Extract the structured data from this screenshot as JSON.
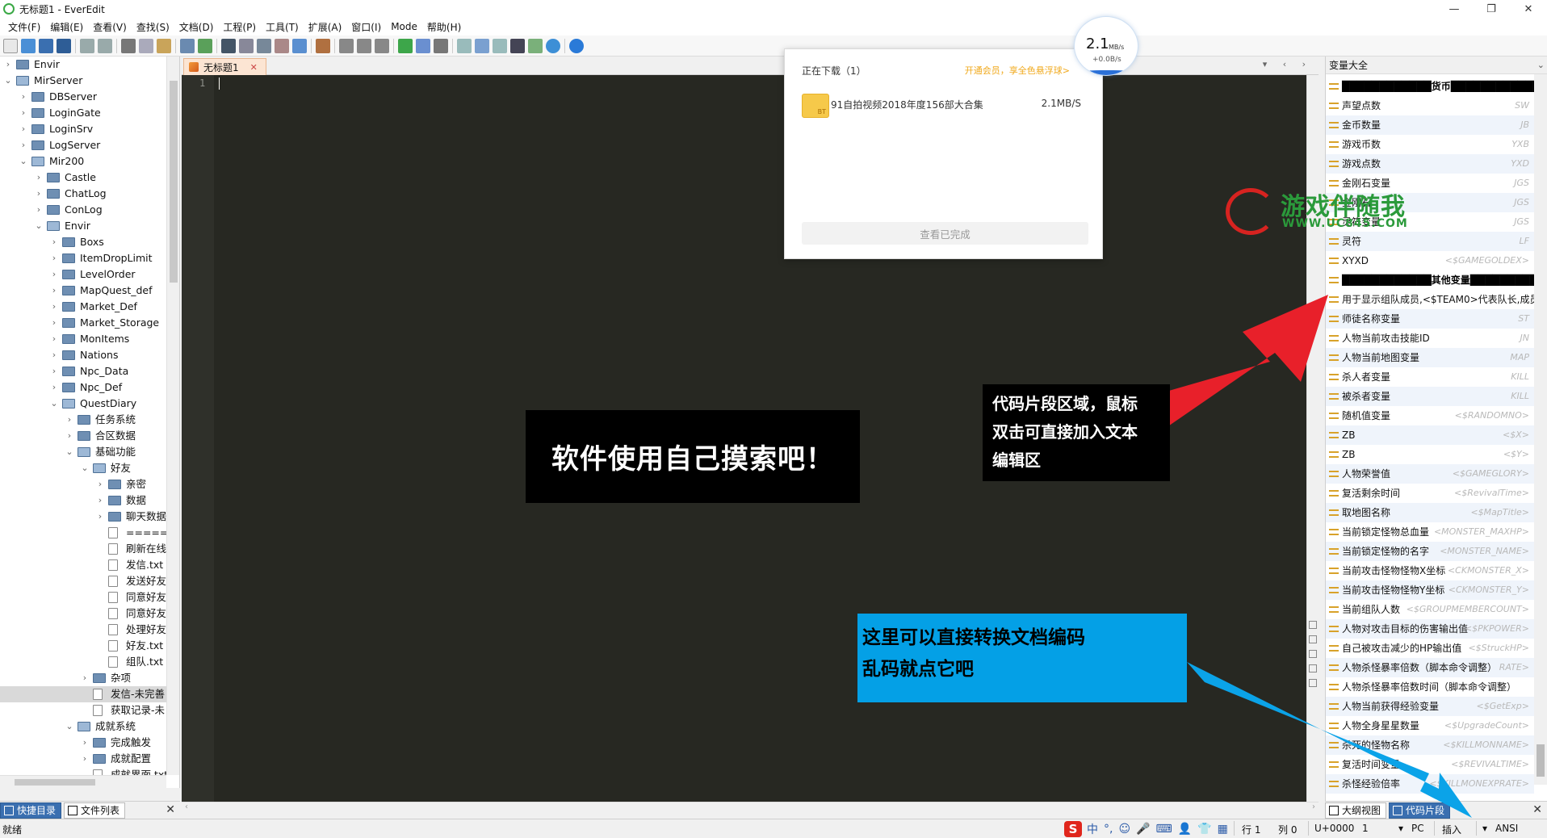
{
  "window": {
    "title": "无标题1 - EverEdit",
    "controls": [
      "—",
      "❐",
      "✕"
    ]
  },
  "menu": [
    "文件(F)",
    "编辑(E)",
    "查看(V)",
    "查找(S)",
    "文档(D)",
    "工程(P)",
    "工具(T)",
    "扩展(A)",
    "窗口(I)",
    "Mode",
    "帮助(H)"
  ],
  "file_tree": [
    {
      "label": "Envir",
      "depth": 0,
      "twisty": "›",
      "icon": "folder"
    },
    {
      "label": "MirServer",
      "depth": 0,
      "twisty": "⌄",
      "icon": "folder-open"
    },
    {
      "label": "DBServer",
      "depth": 1,
      "twisty": "›",
      "icon": "folder"
    },
    {
      "label": "LoginGate",
      "depth": 1,
      "twisty": "›",
      "icon": "folder"
    },
    {
      "label": "LoginSrv",
      "depth": 1,
      "twisty": "›",
      "icon": "folder"
    },
    {
      "label": "LogServer",
      "depth": 1,
      "twisty": "›",
      "icon": "folder"
    },
    {
      "label": "Mir200",
      "depth": 1,
      "twisty": "⌄",
      "icon": "folder-open"
    },
    {
      "label": "Castle",
      "depth": 2,
      "twisty": "›",
      "icon": "folder"
    },
    {
      "label": "ChatLog",
      "depth": 2,
      "twisty": "›",
      "icon": "folder"
    },
    {
      "label": "ConLog",
      "depth": 2,
      "twisty": "›",
      "icon": "folder"
    },
    {
      "label": "Envir",
      "depth": 2,
      "twisty": "⌄",
      "icon": "folder-open"
    },
    {
      "label": "Boxs",
      "depth": 3,
      "twisty": "›",
      "icon": "folder"
    },
    {
      "label": "ItemDropLimit",
      "depth": 3,
      "twisty": "›",
      "icon": "folder"
    },
    {
      "label": "LevelOrder",
      "depth": 3,
      "twisty": "›",
      "icon": "folder"
    },
    {
      "label": "MapQuest_def",
      "depth": 3,
      "twisty": "›",
      "icon": "folder"
    },
    {
      "label": "Market_Def",
      "depth": 3,
      "twisty": "›",
      "icon": "folder"
    },
    {
      "label": "Market_Storage",
      "depth": 3,
      "twisty": "›",
      "icon": "folder"
    },
    {
      "label": "MonItems",
      "depth": 3,
      "twisty": "›",
      "icon": "folder"
    },
    {
      "label": "Nations",
      "depth": 3,
      "twisty": "›",
      "icon": "folder"
    },
    {
      "label": "Npc_Data",
      "depth": 3,
      "twisty": "›",
      "icon": "folder"
    },
    {
      "label": "Npc_Def",
      "depth": 3,
      "twisty": "›",
      "icon": "folder"
    },
    {
      "label": "QuestDiary",
      "depth": 3,
      "twisty": "⌄",
      "icon": "folder-open"
    },
    {
      "label": "任务系统",
      "depth": 4,
      "twisty": "›",
      "icon": "folder"
    },
    {
      "label": "合区数据",
      "depth": 4,
      "twisty": "›",
      "icon": "folder"
    },
    {
      "label": "基础功能",
      "depth": 4,
      "twisty": "⌄",
      "icon": "folder-open"
    },
    {
      "label": "好友",
      "depth": 5,
      "twisty": "⌄",
      "icon": "folder-open"
    },
    {
      "label": "亲密",
      "depth": 6,
      "twisty": "›",
      "icon": "folder"
    },
    {
      "label": "数据",
      "depth": 6,
      "twisty": "›",
      "icon": "folder"
    },
    {
      "label": "聊天数据",
      "depth": 6,
      "twisty": "›",
      "icon": "folder"
    },
    {
      "label": "======",
      "depth": 6,
      "twisty": "",
      "icon": "file"
    },
    {
      "label": "刷新在线",
      "depth": 6,
      "twisty": "",
      "icon": "file"
    },
    {
      "label": "发信.txt",
      "depth": 6,
      "twisty": "",
      "icon": "file"
    },
    {
      "label": "发送好友",
      "depth": 6,
      "twisty": "",
      "icon": "file"
    },
    {
      "label": "同意好友",
      "depth": 6,
      "twisty": "",
      "icon": "file"
    },
    {
      "label": "同意好友",
      "depth": 6,
      "twisty": "",
      "icon": "file"
    },
    {
      "label": "处理好友",
      "depth": 6,
      "twisty": "",
      "icon": "file"
    },
    {
      "label": "好友.txt",
      "depth": 6,
      "twisty": "",
      "icon": "file"
    },
    {
      "label": "组队.txt",
      "depth": 6,
      "twisty": "",
      "icon": "file"
    },
    {
      "label": "杂项",
      "depth": 5,
      "twisty": "›",
      "icon": "folder"
    },
    {
      "label": "发信-未完善",
      "depth": 5,
      "twisty": "",
      "icon": "file",
      "selected": true
    },
    {
      "label": "获取记录-未",
      "depth": 5,
      "twisty": "",
      "icon": "file"
    },
    {
      "label": "成就系统",
      "depth": 4,
      "twisty": "⌄",
      "icon": "folder-open"
    },
    {
      "label": "完成触发",
      "depth": 5,
      "twisty": "›",
      "icon": "folder"
    },
    {
      "label": "成就配置",
      "depth": 5,
      "twisty": "›",
      "icon": "folder"
    },
    {
      "label": "成就界面.txt",
      "depth": 5,
      "twisty": "",
      "icon": "file"
    }
  ],
  "left_tabs": {
    "quick_dir": "快捷目录",
    "file_list": "文件列表",
    "close": "✕"
  },
  "editor": {
    "tab_label": "无标题1",
    "tab_close": "✕",
    "line_number": "1",
    "nav": "▾ ‹ ›"
  },
  "overlay_text": "软件使用自己摸索吧！",
  "download_popup": {
    "title": "正在下载（1）",
    "promo": "开通会员，享全色悬浮球>",
    "file_name": "91自拍视频2018年度156部大合集",
    "speed": "2.1MB/S",
    "button": "查看已完成"
  },
  "speed_bubble": {
    "value": "2.1",
    "unit": "MB/s",
    "upload": "+0.0B/s"
  },
  "snippet_panel": {
    "title": "变量大全",
    "items": [
      {
        "name": "████████████货币████████████",
        "key": "",
        "head": true
      },
      {
        "name": "声望点数",
        "key": "SW"
      },
      {
        "name": "金币数量",
        "key": "JB"
      },
      {
        "name": "游戏币数",
        "key": "YXB"
      },
      {
        "name": "游戏点数",
        "key": "YXD"
      },
      {
        "name": "金刚石变量",
        "key": "JGS"
      },
      {
        "name": "金刚石",
        "key": "JGS"
      },
      {
        "name": "灵符变量",
        "key": "JGS"
      },
      {
        "name": "灵符",
        "key": "LF"
      },
      {
        "name": "XYXD",
        "key": "<$GAMEGOLDEX>"
      },
      {
        "name": "████████████其他变量████████████",
        "key": "",
        "head": true
      },
      {
        "name": "用于显示组队成员,<$TEAM0>代表队长,成员",
        "key": ""
      },
      {
        "name": "师徒名称变量",
        "key": "ST"
      },
      {
        "name": "人物当前攻击技能ID",
        "key": "JN"
      },
      {
        "name": "人物当前地图变量",
        "key": "MAP"
      },
      {
        "name": "杀人者变量",
        "key": "KILL"
      },
      {
        "name": "被杀者变量",
        "key": "KILL"
      },
      {
        "name": "随机值变量",
        "key": "<$RANDOMNO>"
      },
      {
        "name": "ZB",
        "key": "<$X>"
      },
      {
        "name": "ZB",
        "key": "<$Y>"
      },
      {
        "name": "人物荣誉值",
        "key": "<$GAMEGLORY>"
      },
      {
        "name": "复活剩余时间",
        "key": "<$RevivalTime>"
      },
      {
        "name": "取地图名称",
        "key": "<$MapTitle>"
      },
      {
        "name": "当前锁定怪物总血量",
        "key": "<MONSTER_MAXHP>"
      },
      {
        "name": "当前锁定怪物的名字",
        "key": "<MONSTER_NAME>"
      },
      {
        "name": "当前攻击怪物怪物X坐标",
        "key": "<CKMONSTER_X>"
      },
      {
        "name": "当前攻击怪物怪物Y坐标",
        "key": "<CKMONSTER_Y>"
      },
      {
        "name": "当前组队人数",
        "key": "<$GROUPMEMBERCOUNT>"
      },
      {
        "name": "人物对攻击目标的伤害输出值",
        "key": "<$PKPOWER>"
      },
      {
        "name": "自己被攻击减少的HP输出值",
        "key": "<$StruckHP>"
      },
      {
        "name": "人物杀怪暴率倍数（脚本命令调整）",
        "key": "RATE>"
      },
      {
        "name": "人物杀怪暴率倍数时间（脚本命令调整）",
        "key": ""
      },
      {
        "name": "人物当前获得经验变量",
        "key": "<$GetExp>"
      },
      {
        "name": "人物全身星星数量",
        "key": "<$UpgradeCount>"
      },
      {
        "name": "杀死的怪物名称",
        "key": "<$KILLMONNAME>"
      },
      {
        "name": "复活时间变量",
        "key": "<$REVIVALTIME>"
      },
      {
        "name": "杀怪经验倍率",
        "key": "<$KILLMONEXPRATE>"
      }
    ]
  },
  "right_tabs": {
    "outline": "大纲视图",
    "snippets": "代码片段",
    "close": "✕"
  },
  "callouts": {
    "snippet": [
      "代码片段区域，鼠标",
      "双击可直接加入文本",
      "编辑区"
    ],
    "encoding": [
      "这里可以直接转换文档编码",
      "乱码就点它吧"
    ]
  },
  "watermark": {
    "cn": "游戏伴随我",
    "en": "WWW.UC845.COM"
  },
  "status": {
    "ready": "就绪",
    "ime_logo": "S",
    "ime_icons": [
      "中",
      "°,",
      "☺",
      "🎤",
      "⌨",
      "👤",
      "👕",
      "▦"
    ],
    "line": "行 1",
    "col": "列 0",
    "code": "U+0000",
    "num": "1",
    "eol": "PC",
    "mode": "插入",
    "encoding": "ANSI"
  },
  "colors": {
    "editor_bg": "#272822",
    "arrow_red": "#e8202a",
    "arrow_blue": "#0ba3e8",
    "callout_blue": "#04a0e6",
    "tab_active_blue": "#3a6fb0"
  }
}
